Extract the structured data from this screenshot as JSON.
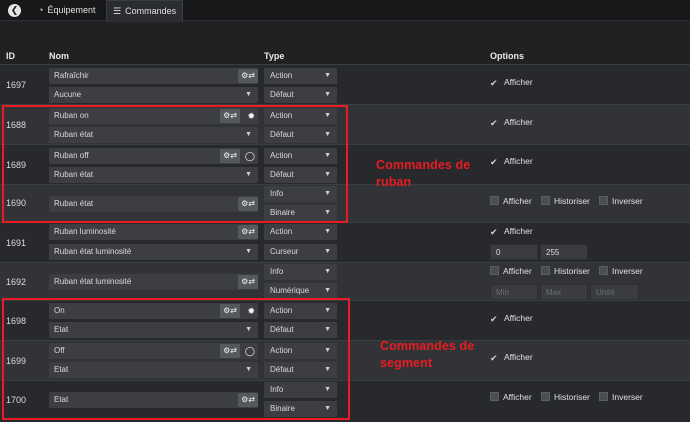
{
  "tabs": {
    "equipement": "Équipement",
    "commandes": "Commandes"
  },
  "table": {
    "headers": {
      "id": "ID",
      "nom": "Nom",
      "type": "Type",
      "options": "Options"
    }
  },
  "opts": {
    "afficher": "Afficher",
    "historiser": "Historiser",
    "inverser": "Inverser"
  },
  "rows": [
    {
      "id": "1697",
      "name": "Rafraîchir",
      "value": "Aucune",
      "type": "Action",
      "subtype": "Défaut"
    },
    {
      "id": "1688",
      "name": "Ruban on",
      "value": "Ruban état",
      "type": "Action",
      "subtype": "Défaut"
    },
    {
      "id": "1689",
      "name": "Ruban off",
      "value": "Ruban état",
      "type": "Action",
      "subtype": "Défaut"
    },
    {
      "id": "1690",
      "name": "Ruban état",
      "type": "Info",
      "subtype": "Binaire"
    },
    {
      "id": "1691",
      "name": "Ruban luminosité",
      "value": "Ruban état luminosité",
      "type": "Action",
      "subtype": "Curseur",
      "min": "0",
      "max": "255"
    },
    {
      "id": "1692",
      "name": "Ruban état luminosité",
      "type": "Info",
      "subtype": "Numérique",
      "min_ph": "Min",
      "max_ph": "Max",
      "unit_ph": "Unité"
    },
    {
      "id": "1698",
      "name": "On",
      "value": "Etat",
      "type": "Action",
      "subtype": "Défaut"
    },
    {
      "id": "1699",
      "name": "Off",
      "value": "Etat",
      "type": "Action",
      "subtype": "Défaut"
    },
    {
      "id": "1700",
      "name": "Etat",
      "type": "Info",
      "subtype": "Binaire"
    }
  ],
  "annotations": {
    "ruban_1": "Commandes de",
    "ruban_2": "ruban",
    "segment_1": "Commandes de",
    "segment_2": "segment"
  },
  "colors": {
    "annotation": "#e81c22",
    "background": "#1f2123"
  }
}
